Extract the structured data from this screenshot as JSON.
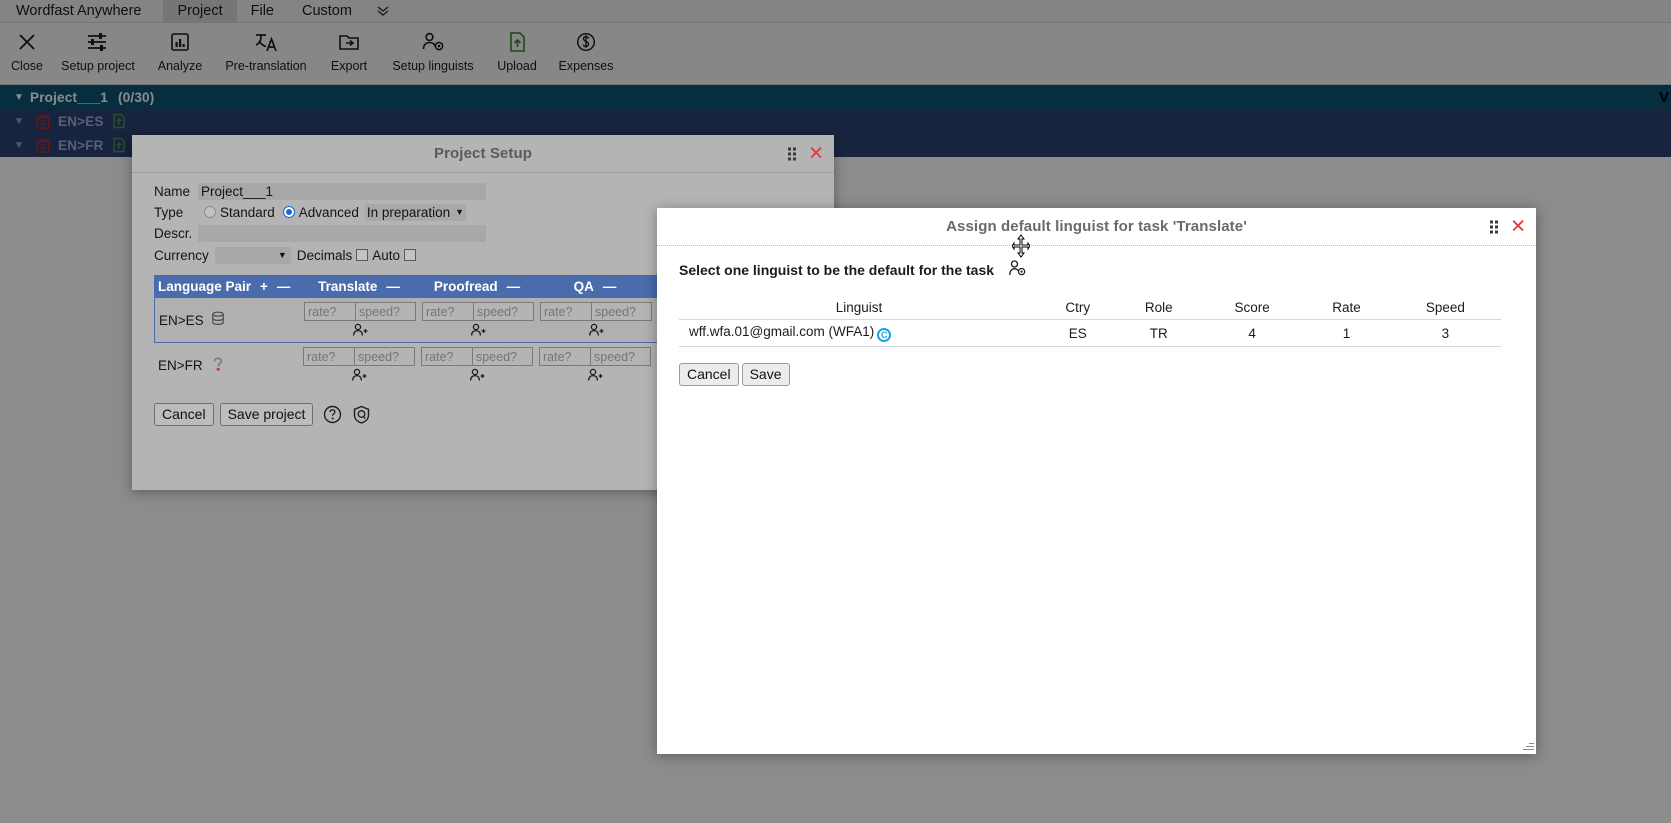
{
  "menubar": {
    "brand": "Wordfast Anywhere",
    "items": [
      {
        "label": "Project",
        "active": true
      },
      {
        "label": "File",
        "active": false
      },
      {
        "label": "Custom",
        "active": false
      }
    ],
    "overflow_icon": "chevron-double-down-icon"
  },
  "toolbar": {
    "buttons": [
      {
        "label": "Close",
        "icon": "close-x-icon"
      },
      {
        "label": "Setup project",
        "icon": "sliders-icon"
      },
      {
        "label": "Analyze",
        "icon": "bar-chart-icon"
      },
      {
        "label": "Pre-translation",
        "icon": "translate-icon"
      },
      {
        "label": "Export",
        "icon": "folder-export-icon"
      },
      {
        "label": "Setup linguists",
        "icon": "user-gear-icon"
      },
      {
        "label": "Upload",
        "icon": "file-upload-icon"
      },
      {
        "label": "Expenses",
        "icon": "dollar-circle-icon"
      }
    ]
  },
  "tree": {
    "project": {
      "label": "Project___1",
      "count": "(0/30)",
      "caret": "caret-down-icon"
    },
    "nodes": [
      {
        "label": "EN>ES",
        "caret": "caret-down-icon",
        "status_icon": "delete-box-icon",
        "doc_icon": "document-add-icon"
      },
      {
        "label": "EN>FR",
        "caret": "caret-down-icon",
        "status_icon": "delete-box-icon",
        "doc_icon": "document-add-icon"
      }
    ],
    "right_marker": "V"
  },
  "project_setup": {
    "title": "Project Setup",
    "close_icon": "close-icon",
    "drag_icon": "drag-handle-icon",
    "fields": {
      "name_label": "Name",
      "name_value": "Project___1",
      "type_label": "Type",
      "type_standard": "Standard",
      "type_advanced": "Advanced",
      "type_selected": "Advanced",
      "status_value": "In preparation",
      "descr_label": "Descr.",
      "descr_value": "",
      "currency_label": "Currency",
      "currency_value": "",
      "decimals_label": "Decimals",
      "decimals_checked": false,
      "auto_label": "Auto",
      "auto_checked": false
    },
    "table": {
      "columns": [
        {
          "label": "Language Pair",
          "add": "+",
          "remove": "—"
        },
        {
          "label": "Translate",
          "remove": "—"
        },
        {
          "label": "Proofread",
          "remove": "—"
        },
        {
          "label": "QA",
          "remove": "—"
        }
      ],
      "rate_placeholder": "rate?",
      "speed_placeholder": "speed?",
      "assign_icon": "add-person-icon",
      "rows": [
        {
          "pair": "EN>ES",
          "pair_icon": "database-icon",
          "selected": true,
          "cells": [
            {
              "rate": "",
              "speed": ""
            },
            {
              "rate": "",
              "speed": ""
            },
            {
              "rate": "",
              "speed": ""
            }
          ]
        },
        {
          "pair": "EN>FR",
          "pair_icon": "question-warning-icon",
          "selected": false,
          "cells": [
            {
              "rate": "",
              "speed": ""
            },
            {
              "rate": "",
              "speed": ""
            },
            {
              "rate": "",
              "speed": ""
            }
          ]
        }
      ]
    },
    "footer": {
      "cancel_label": "Cancel",
      "save_label": "Save project",
      "help_icon": "question-circle-icon",
      "shield_icon": "shield-badge-icon"
    }
  },
  "assign_linguist": {
    "title": "Assign default linguist for task 'Translate'",
    "close_icon": "close-icon",
    "drag_icon": "drag-handle-icon",
    "subtitle": "Select one linguist to be the default for the task",
    "subtitle_icon": "user-gear-icon",
    "table": {
      "headers": [
        "Linguist",
        "Ctry",
        "Role",
        "Score",
        "Rate",
        "Speed"
      ],
      "rows": [
        {
          "linguist": "wff.wfa.01@gmail.com (WFA1)",
          "linguist_badge": "C",
          "ctry": "ES",
          "role": "TR",
          "score": "4",
          "rate": "1",
          "speed": "3"
        }
      ]
    },
    "footer": {
      "cancel_label": "Cancel",
      "save_label": "Save"
    },
    "resize_icon": "resize-grip-icon"
  },
  "colors": {
    "tree_project_bg": "#0b5473",
    "tree_lang_bg": "#2c4273",
    "table_header_bg": "#4a6cad",
    "accent_red": "#e23b34",
    "radio_blue": "#1c66d6",
    "badge_blue": "#18a5e0"
  }
}
